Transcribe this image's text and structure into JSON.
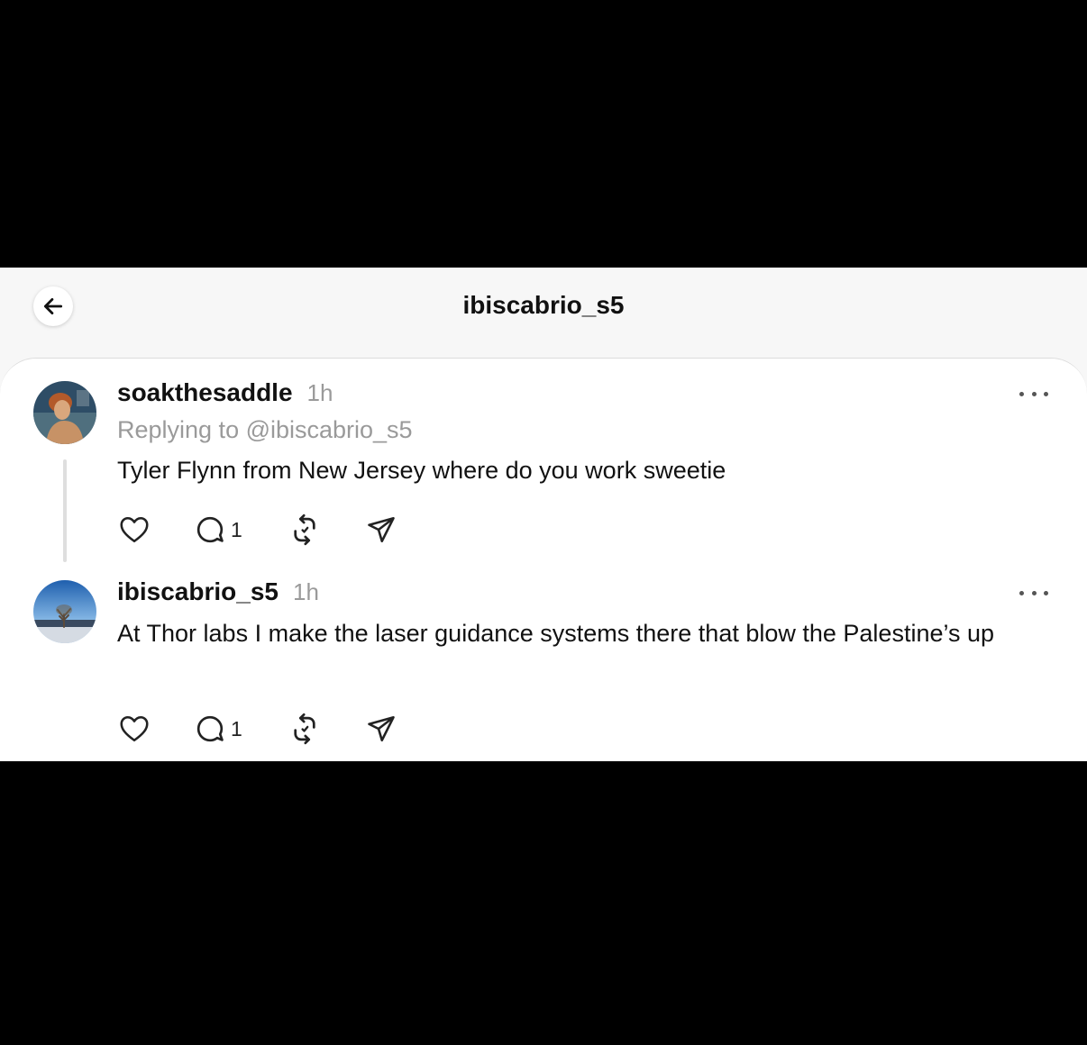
{
  "header": {
    "title": "ibiscabrio_s5"
  },
  "posts": [
    {
      "username": "soakthesaddle",
      "time": "1h",
      "replying_to": "Replying to @ibiscabrio_s5",
      "text": "Tyler Flynn from New Jersey where do you work sweetie",
      "reply_count": "1",
      "avatar": "painting-portrait-avatar"
    },
    {
      "username": "ibiscabrio_s5",
      "time": "1h",
      "text": "At Thor labs I make the laser guidance systems there that blow the Palestine’s up",
      "reply_count": "1",
      "avatar": "lake-tree-sky-avatar"
    }
  ],
  "icons": [
    "back-arrow-icon",
    "heart-icon",
    "comment-icon",
    "repost-icon",
    "share-icon",
    "more-icon"
  ],
  "colors": {
    "background": "#000000",
    "surface": "#ffffff",
    "muted_text": "#9a9a9a",
    "text": "#111111"
  }
}
